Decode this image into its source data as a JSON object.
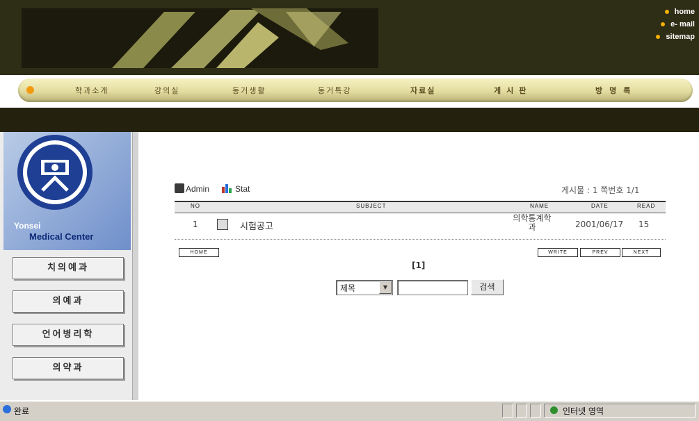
{
  "header": {
    "links": [
      "home",
      "e- mail",
      "sitemap"
    ]
  },
  "nav": {
    "items": [
      "학과소개",
      "강의실",
      "동거생활",
      "동거특강",
      "자료실",
      "게시판",
      "방명록"
    ]
  },
  "sidebar": {
    "logo_text": [
      "Yonsei",
      "Medical Center"
    ],
    "seal_text": "YONSEI MEDICAL CENTER",
    "buttons": [
      "치의예과",
      "의예과",
      "언어병리학",
      "의약과"
    ]
  },
  "board": {
    "admin_label": "Admin",
    "stat_label": "Stat",
    "post_count": "게시물 : 1 쪽번호 1/1",
    "columns": [
      "NO",
      "SUBJECT",
      "NAME",
      "DATE",
      "READ"
    ],
    "rows": [
      {
        "no": "1",
        "subject": "시험공고",
        "name": "의학통계학과",
        "date": "2001/06/17",
        "read": "15"
      }
    ],
    "home_button": "HOME",
    "write_button": "WRITE",
    "prev_button": "PREV",
    "next_button": "NEXT",
    "pagination": "[1]",
    "search": {
      "select_value": "제목",
      "input_value": "",
      "button": "검색"
    }
  },
  "statusbar": {
    "left": "완료",
    "zone": "인터넷 영역"
  },
  "colors": {
    "header_bg": "#2e2d16",
    "nav_gold": "#e3dca0",
    "accent_orange": "#f29a10",
    "sidebar_blue": "#6f8fcb"
  }
}
